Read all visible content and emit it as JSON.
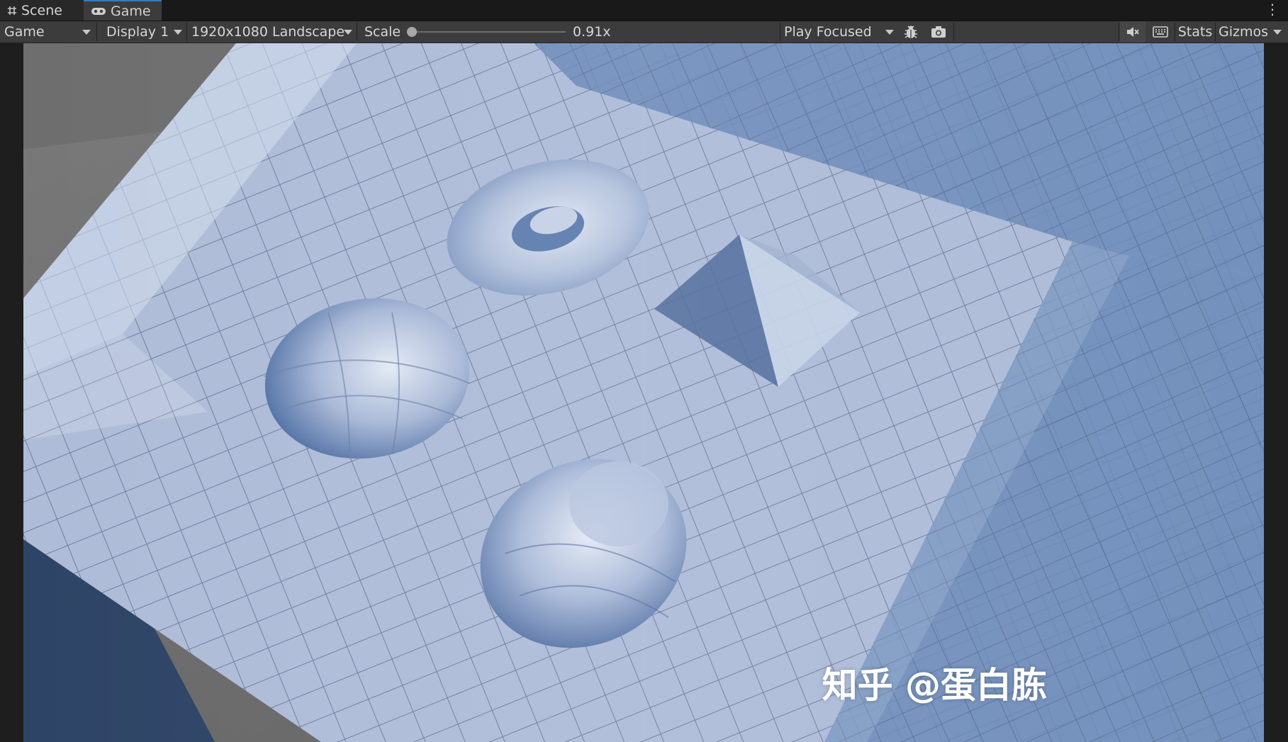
{
  "tabs": [
    {
      "label": "Scene",
      "icon": "grid-hash-icon",
      "active": false
    },
    {
      "label": "Game",
      "icon": "gamepad-icon",
      "active": true
    }
  ],
  "toolbar": {
    "game_dropdown": "Game",
    "display_dropdown": "Display 1",
    "resolution_dropdown": "1920x1080 Landscape",
    "scale_label": "Scale",
    "scale_value": "0.91x",
    "scale_slider_level": 0.0,
    "play_mode_dropdown": "Play Focused",
    "stats_label": "Stats",
    "gizmos_label": "Gizmos"
  },
  "icons": {
    "tab_menu": "kebab-menu-icon",
    "debug": "bug-icon",
    "screenshot": "camera-icon",
    "mute": "mute-audio-icon",
    "shortcuts": "keyboard-icon"
  },
  "viewport": {
    "watermark": "知乎 @蛋白胨",
    "colors": {
      "surface": "#aab9d6",
      "shadow": "#5a7aa8",
      "floor": "#6c6c6c"
    }
  }
}
